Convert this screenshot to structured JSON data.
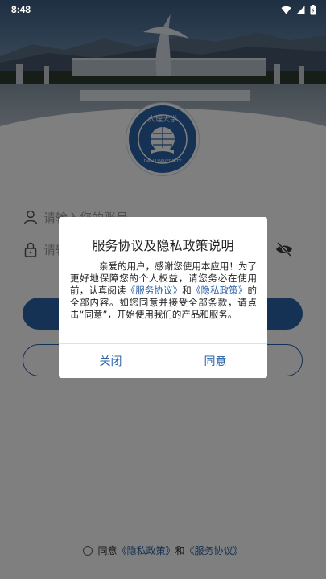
{
  "status_bar": {
    "time": "8:48",
    "icons": [
      "wifi-icon",
      "signal-icon",
      "battery-icon"
    ]
  },
  "header": {
    "photo": "campus-photo",
    "emblem": "university-emblem-icon",
    "emblem_text_top": "大理大学",
    "emblem_text_bottom": "DALI UNIVERSITY"
  },
  "login": {
    "account_placeholder": "请输入您的账号",
    "password_placeholder": "请输入您的密码",
    "user_icon": "user-icon",
    "lock_icon": "lock-icon",
    "eye_icon": "eye-off-icon"
  },
  "agreement": {
    "prefix": "同意",
    "privacy_link": "《隐私政策》",
    "joiner": "和",
    "service_link": "《服务协议》"
  },
  "dialog": {
    "title": "服务协议及隐私政策说明",
    "body_p1": "亲爱的用户，感谢您使用本应用！为了更好地保障您的个人权益，请您务必在使用前，认真阅读",
    "service_link": "《服务协议》",
    "and": "和",
    "privacy_link": "《隐私政策》",
    "body_p2": "的全部内容。如您同意并接受全部条款，请点击“同意”，开始使用我们的产品和服务。",
    "close_label": "关闭",
    "agree_label": "同意"
  },
  "colors": {
    "primary": "#2b63a7",
    "overlay": "rgba(0,0,0,0.5)"
  }
}
